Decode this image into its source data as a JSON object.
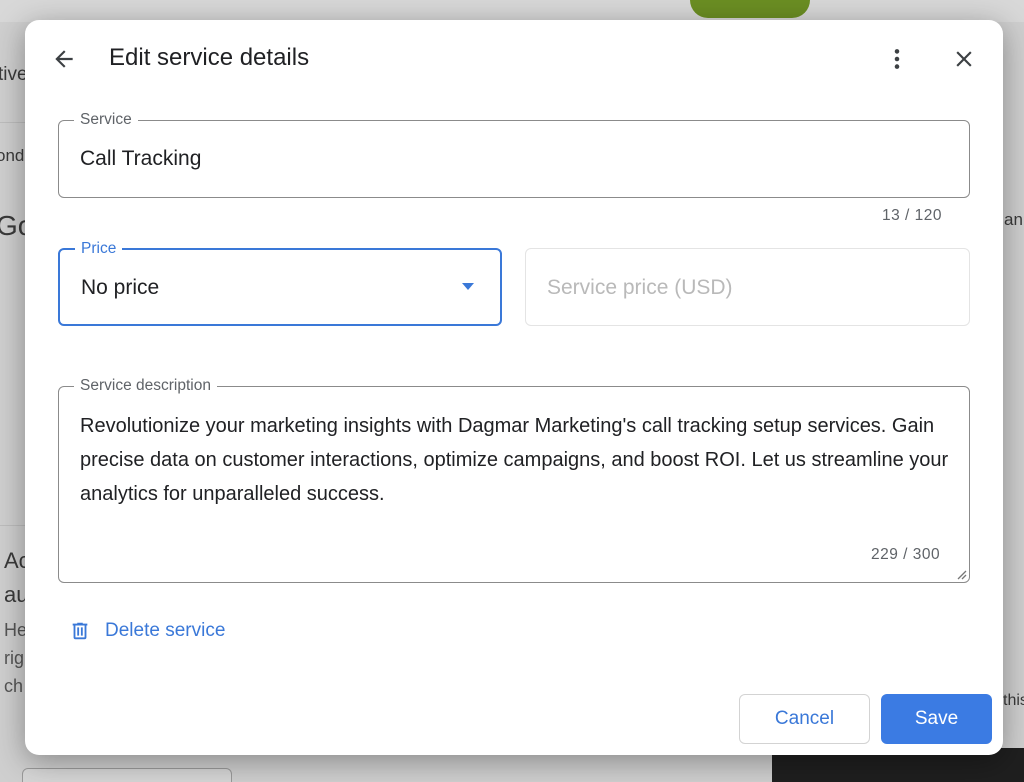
{
  "background": {
    "snippets": [
      "tive",
      "ond",
      "Go",
      "ani",
      "Ac",
      "au",
      "He",
      "rig",
      "ch",
      "this"
    ]
  },
  "dialog": {
    "title": "Edit service details",
    "back_icon": "arrow-left-icon",
    "more_icon": "more-vertical-icon",
    "close_icon": "close-icon",
    "service": {
      "label": "Service",
      "value": "Call Tracking",
      "counter": "13 / 120"
    },
    "price": {
      "label": "Price",
      "selected": "No price"
    },
    "service_price": {
      "placeholder": "Service price (USD)"
    },
    "description": {
      "label": "Service description",
      "value": "Revolutionize your marketing insights with Dagmar Marketing's call tracking setup services. Gain precise data on customer interactions, optimize campaigns, and boost ROI. Let us streamline your analytics for unparalleled success.",
      "counter": "229 / 300"
    },
    "delete_label": "Delete service",
    "cancel_label": "Cancel",
    "save_label": "Save"
  },
  "colors": {
    "accent": "#3a78d8",
    "save_bg": "#3b7be3"
  }
}
